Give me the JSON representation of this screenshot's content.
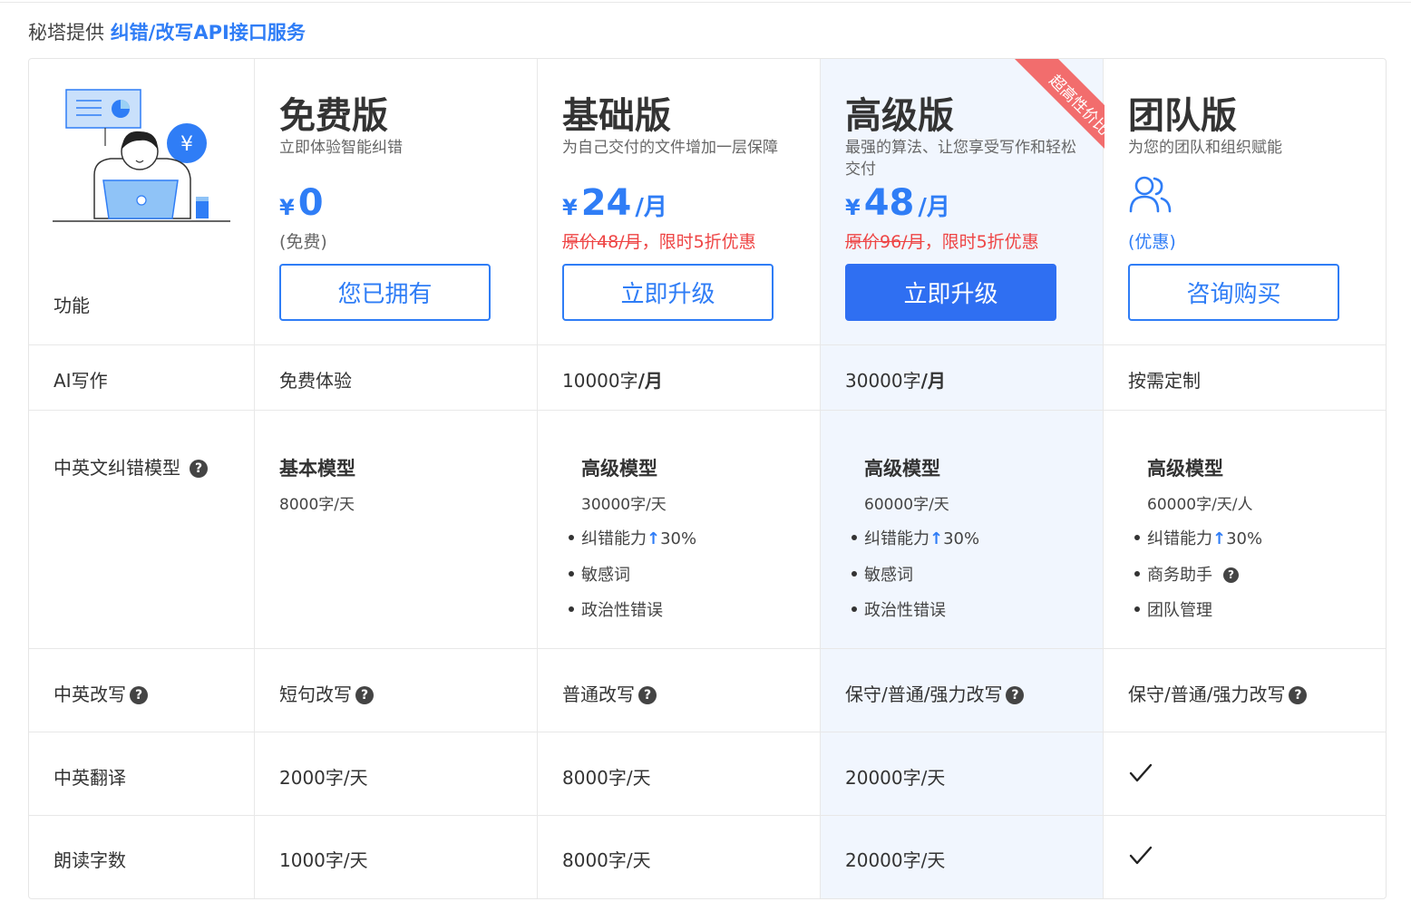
{
  "header": {
    "prefix": "秘塔提供",
    "link": "纠错/改写API接口服务"
  },
  "feature_col": {
    "header_label": "功能",
    "rows": [
      {
        "label": "AI写作"
      },
      {
        "label": "中英文纠错模型"
      },
      {
        "label": "中英改写"
      },
      {
        "label": "中英翻译"
      },
      {
        "label": "朗读字数"
      }
    ]
  },
  "plans": [
    {
      "name": "免费版",
      "desc": "立即体验智能纠错",
      "currency": "¥",
      "price": "0",
      "per": "",
      "note": "(免费)",
      "button": "您已拥有"
    },
    {
      "name": "基础版",
      "desc": "为自己交付的文件增加一层保障",
      "currency": "¥",
      "price": "24",
      "per": "/月",
      "orig_price": "原价48/月",
      "promo": "，限时5折优惠",
      "button": "立即升级"
    },
    {
      "name": "高级版",
      "desc": "最强的算法、让您享受写作和轻松交付",
      "currency": "¥",
      "price": "48",
      "per": "/月",
      "orig_price": "原价96/月",
      "promo": "，限时5折优惠",
      "button": "立即升级",
      "ribbon": "超高性价比"
    },
    {
      "name": "团队版",
      "desc": "为您的团队和组织赋能",
      "icon": "team-icon",
      "note": "(优惠)",
      "button": "咨询购买"
    }
  ],
  "rows": {
    "ai_writing": [
      {
        "num": "",
        "unit": "免费体验"
      },
      {
        "num": "10000字",
        "unit": "/月"
      },
      {
        "num": "30000字",
        "unit": "/月"
      },
      {
        "num": "",
        "unit": "按需定制"
      }
    ],
    "correction": [
      {
        "title": "基本模型",
        "sub": "8000字/天",
        "bullets": []
      },
      {
        "title": "高级模型",
        "sub": "30000字/天",
        "bullets": [
          "纠错能力",
          "敏感词",
          "政治性错误"
        ],
        "boost": "30%"
      },
      {
        "title": "高级模型",
        "sub": "60000字/天",
        "bullets": [
          "纠错能力",
          "敏感词",
          "政治性错误"
        ],
        "boost": "30%"
      },
      {
        "title": "高级模型",
        "sub": "60000字/天/人",
        "bullets": [
          "纠错能力",
          "商务助手",
          "团队管理"
        ],
        "boost": "30%"
      }
    ],
    "rewrite": [
      "短句改写",
      "普通改写",
      "保守/普通/强力改写",
      "保守/普通/强力改写"
    ],
    "translate": [
      "2000字/天",
      "8000字/天",
      "20000字/天",
      "check"
    ],
    "read_aloud": [
      "1000字/天",
      "8000字/天",
      "20000字/天",
      "check"
    ]
  },
  "icons": {
    "help": "question-circle-icon",
    "up": "arrow-up-icon",
    "check": "check-icon",
    "team": "users-icon"
  },
  "colors": {
    "accent": "#2f7df6",
    "primary_button": "#2f6ff2",
    "promo_red": "#ee4444",
    "ribbon": "#f26d6d",
    "highlight_column": "#f1f6fe"
  }
}
